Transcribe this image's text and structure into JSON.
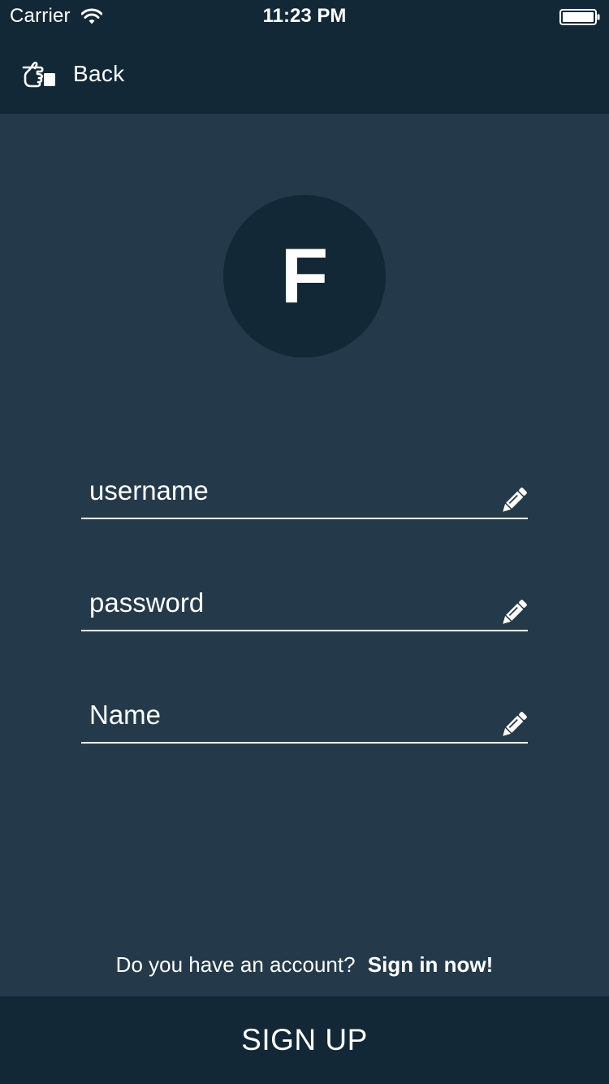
{
  "status_bar": {
    "carrier": "Carrier",
    "time": "11:23 PM",
    "wifi_icon": "wifi-icon",
    "battery_icon": "battery-icon"
  },
  "nav": {
    "back_label": "Back",
    "back_icon": "pointing-hand-icon"
  },
  "avatar": {
    "letter": "F"
  },
  "form": {
    "fields": [
      {
        "placeholder": "username",
        "value": "",
        "icon": "pencil-icon"
      },
      {
        "placeholder": "password",
        "value": "",
        "icon": "pencil-icon"
      },
      {
        "placeholder": "Name",
        "value": "",
        "icon": "pencil-icon"
      }
    ]
  },
  "footer": {
    "account_prompt": "Do you have an account?",
    "signin_link": "Sign in now!",
    "signup_label": "SIGN UP"
  },
  "colors": {
    "background": "#243a4a",
    "bar": "#132837",
    "text": "#ffffff"
  }
}
